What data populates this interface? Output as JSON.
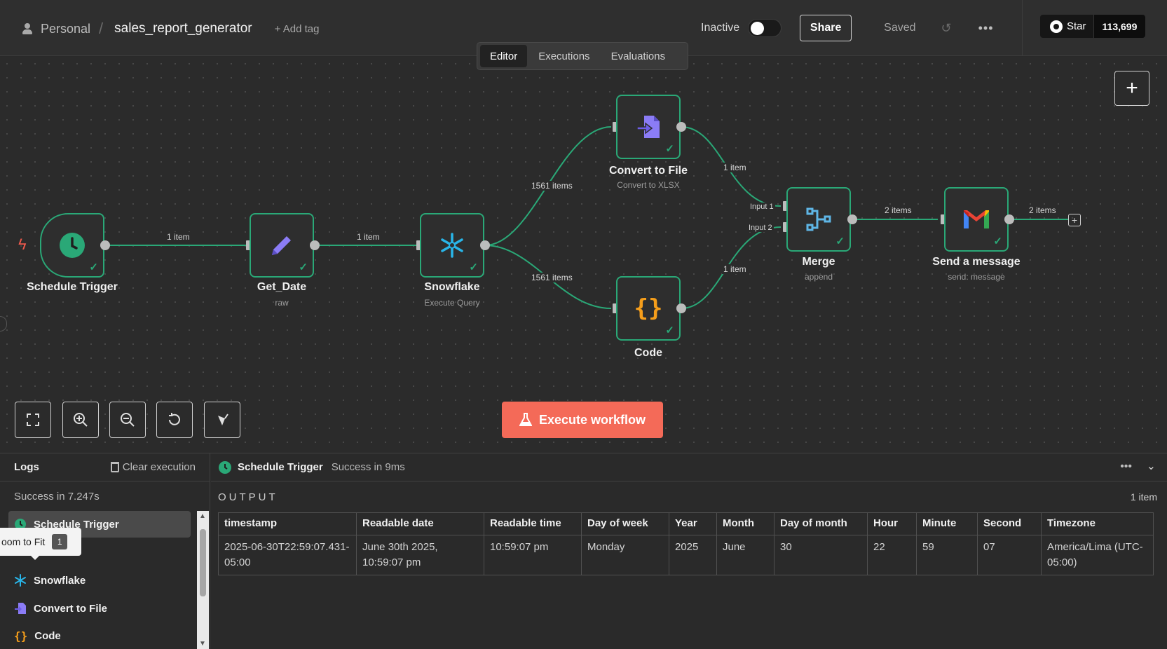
{
  "header": {
    "project": "Personal",
    "separator": "/",
    "workflow_name": "sales_report_generator",
    "add_tag": "+ Add tag",
    "status_label": "Inactive",
    "share_label": "Share",
    "saved_label": "Saved",
    "github_star_label": "Star",
    "github_star_count": "113,699"
  },
  "tabs": [
    {
      "label": "Editor",
      "active": true
    },
    {
      "label": "Executions",
      "active": false
    },
    {
      "label": "Evaluations",
      "active": false
    }
  ],
  "nodes": {
    "schedule": {
      "title": "Schedule Trigger",
      "icon": "clock-icon"
    },
    "get_date": {
      "title": "Get_Date",
      "subtitle": "raw",
      "icon": "pencil-icon"
    },
    "snowflake": {
      "title": "Snowflake",
      "subtitle": "Execute Query",
      "icon": "snowflake-icon"
    },
    "convert": {
      "title": "Convert to File",
      "subtitle": "Convert to XLSX",
      "icon": "file-convert-icon"
    },
    "code": {
      "title": "Code",
      "icon": "braces-icon"
    },
    "merge": {
      "title": "Merge",
      "subtitle": "append",
      "icon": "merge-icon",
      "input1": "Input 1",
      "input2": "Input 2"
    },
    "gmail": {
      "title": "Send a message",
      "subtitle": "send: message",
      "icon": "gmail-icon"
    }
  },
  "edges": {
    "e1": "1 item",
    "e2": "1 item",
    "e3": "1561 items",
    "e4": "1561 items",
    "e5": "1 item",
    "e6": "1 item",
    "e7": "2 items",
    "e8": "2 items"
  },
  "canvas": {
    "execute_label": "Execute workflow",
    "accent": "#f46a58",
    "success": "#2aa877"
  },
  "logs": {
    "title": "Logs",
    "clear_label": "Clear execution",
    "summary": "Success in 7.247s",
    "tooltip_label": "oom to Fit",
    "tooltip_key": "1",
    "items": [
      "Schedule Trigger",
      "Snowflake",
      "Convert to File",
      "Code"
    ]
  },
  "output": {
    "node_name": "Schedule Trigger",
    "status": "Success in 9ms",
    "section_label": "OUTPUT",
    "item_count": "1 item",
    "columns": [
      "timestamp",
      "Readable date",
      "Readable time",
      "Day of week",
      "Year",
      "Month",
      "Day of month",
      "Hour",
      "Minute",
      "Second",
      "Timezone"
    ],
    "rows": [
      [
        "2025-06-30T22:59:07.431-05:00",
        "June 30th 2025, 10:59:07 pm",
        "10:59:07 pm",
        "Monday",
        "2025",
        "June",
        "30",
        "22",
        "59",
        "07",
        "America/Lima (UTC-05:00)"
      ]
    ]
  }
}
